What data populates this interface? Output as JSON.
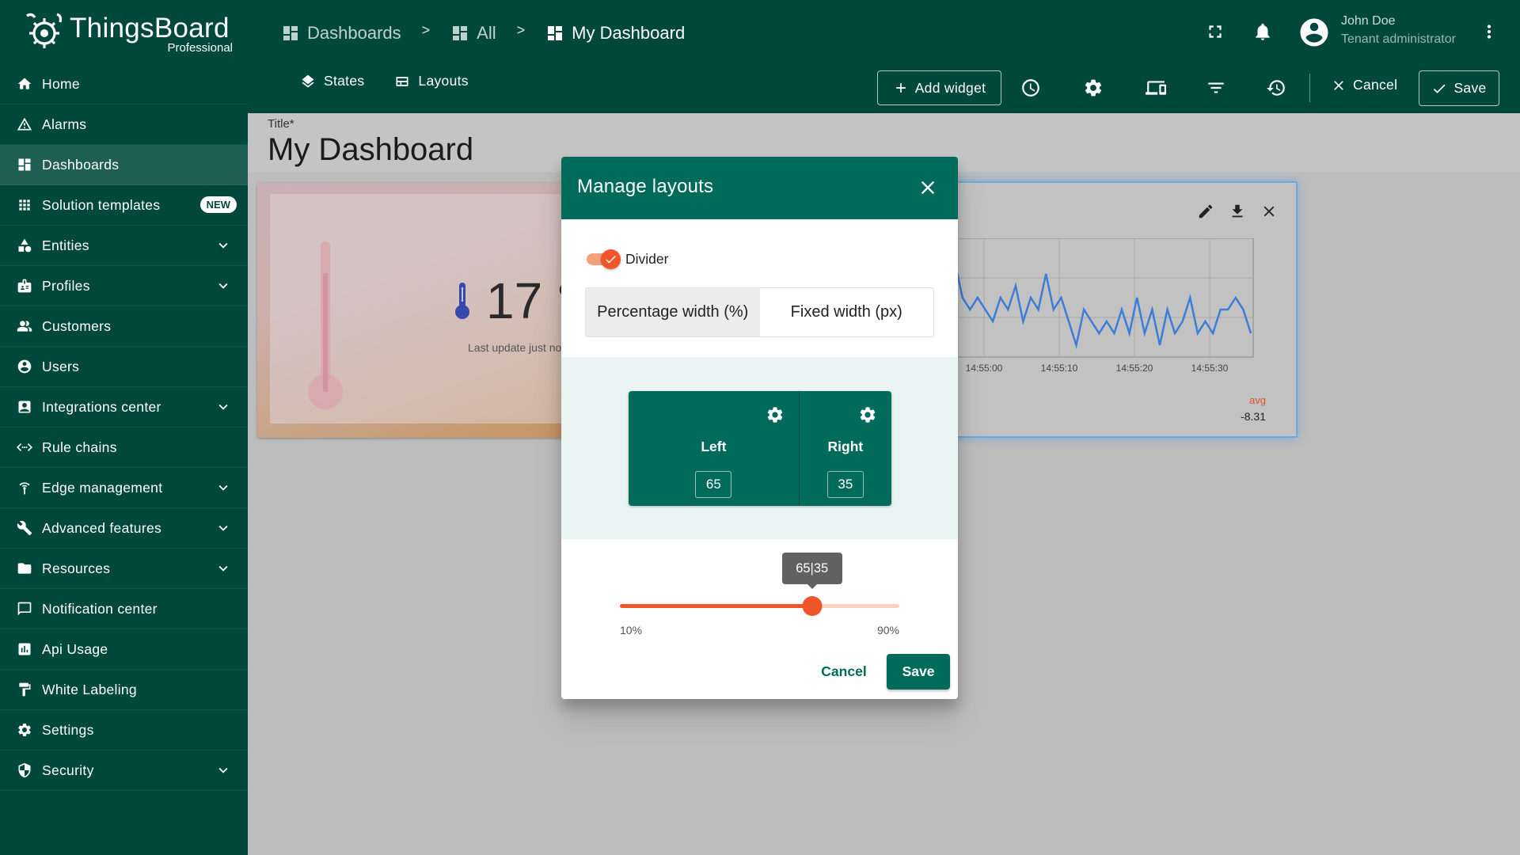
{
  "app": {
    "name": "ThingsBoard",
    "edition": "Professional"
  },
  "sidebar": {
    "items": [
      {
        "label": "Home",
        "icon": "home-icon",
        "expandable": false,
        "active": false
      },
      {
        "label": "Alarms",
        "icon": "alarm-warning-icon",
        "expandable": false,
        "active": false
      },
      {
        "label": "Dashboards",
        "icon": "dashboard-icon",
        "expandable": false,
        "active": true
      },
      {
        "label": "Solution templates",
        "icon": "apps-grid-icon",
        "expandable": false,
        "active": false,
        "badge": "NEW"
      },
      {
        "label": "Entities",
        "icon": "entities-icon",
        "expandable": true,
        "active": false
      },
      {
        "label": "Profiles",
        "icon": "profiles-icon",
        "expandable": true,
        "active": false
      },
      {
        "label": "Customers",
        "icon": "customers-icon",
        "expandable": false,
        "active": false
      },
      {
        "label": "Users",
        "icon": "user-icon",
        "expandable": false,
        "active": false
      },
      {
        "label": "Integrations center",
        "icon": "integrations-icon",
        "expandable": true,
        "active": false
      },
      {
        "label": "Rule chains",
        "icon": "rule-chains-icon",
        "expandable": false,
        "active": false
      },
      {
        "label": "Edge management",
        "icon": "edge-icon",
        "expandable": true,
        "active": false
      },
      {
        "label": "Advanced features",
        "icon": "tools-icon",
        "expandable": true,
        "active": false
      },
      {
        "label": "Resources",
        "icon": "folder-icon",
        "expandable": true,
        "active": false
      },
      {
        "label": "Notification center",
        "icon": "notification-center-icon",
        "expandable": false,
        "active": false
      },
      {
        "label": "Api Usage",
        "icon": "api-usage-icon",
        "expandable": false,
        "active": false
      },
      {
        "label": "White Labeling",
        "icon": "paint-roller-icon",
        "expandable": false,
        "active": false
      },
      {
        "label": "Settings",
        "icon": "gear-icon",
        "expandable": false,
        "active": false
      },
      {
        "label": "Security",
        "icon": "shield-icon",
        "expandable": true,
        "active": false
      }
    ]
  },
  "header": {
    "breadcrumbs": [
      {
        "label": "Dashboards"
      },
      {
        "label": "All"
      },
      {
        "label": "My Dashboard"
      }
    ],
    "separator": ">",
    "user": {
      "name": "John Doe",
      "role": "Tenant administrator"
    }
  },
  "toolbar": {
    "states_label": "States",
    "layouts_label": "Layouts",
    "add_widget_label": "Add widget",
    "cancel_label": "Cancel",
    "save_label": "Save"
  },
  "dashboard": {
    "title_label": "Title*",
    "title_value": "My Dashboard",
    "temperature_widget": {
      "value": "17 °",
      "last_update": "Last update just no"
    },
    "chart_widget": {
      "x_ticks": [
        "14:55:00",
        "14:55:10",
        "14:55:20",
        "14:55:30"
      ],
      "legend_key": "avg",
      "legend_value": "-8.31",
      "line_color": "#3b7dd8",
      "values": [
        -5,
        -7,
        -5,
        -8,
        -9,
        -8,
        -9,
        -10,
        -8,
        -9,
        -7,
        -10,
        -8,
        -9,
        -6,
        -9,
        -8,
        -10,
        -12,
        -9,
        -10,
        -11,
        -10,
        -11,
        -9,
        -11,
        -8,
        -11,
        -9,
        -12,
        -9,
        -11,
        -10,
        -8,
        -11,
        -10,
        -11,
        -9,
        -9,
        -8,
        -9,
        -11
      ]
    }
  },
  "dialog": {
    "title": "Manage layouts",
    "divider_label": "Divider",
    "divider_enabled": true,
    "width_mode_options": [
      "Percentage width (%)",
      "Fixed width (px)"
    ],
    "width_mode_selected": 0,
    "left_label": "Left",
    "left_value": "65",
    "right_label": "Right",
    "right_value": "35",
    "slider_tooltip": "65|35",
    "slider_value_percent": 65,
    "slider_min_label": "10%",
    "slider_max_label": "90%",
    "slider_min": 10,
    "slider_max": 90,
    "cancel_label": "Cancel",
    "save_label": "Save"
  },
  "colors": {
    "primary": "#00483c",
    "dialog_primary": "#006b5a",
    "accent": "#f0562a"
  }
}
